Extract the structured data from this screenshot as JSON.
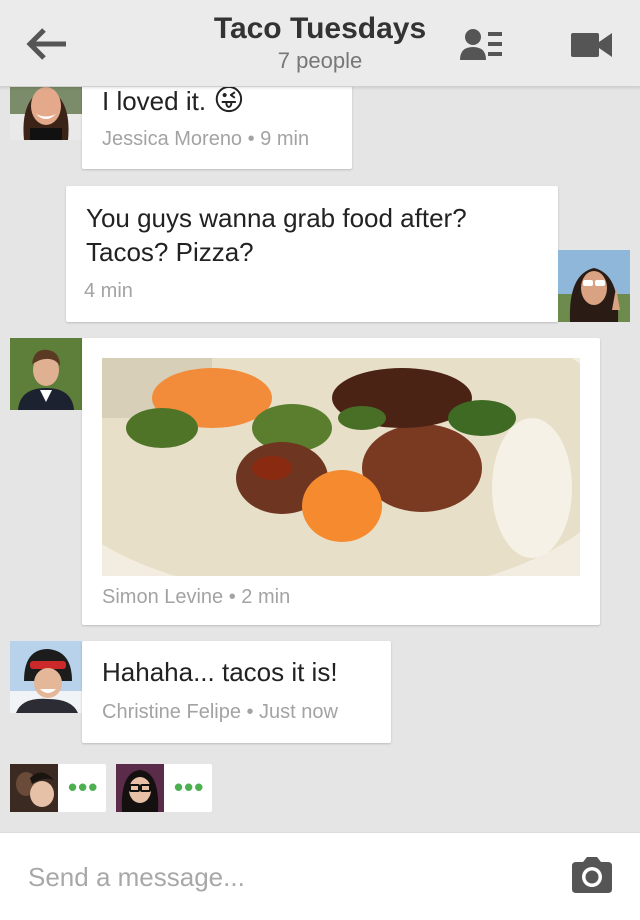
{
  "header": {
    "title": "Taco Tuesdays",
    "subtitle": "7 people",
    "icons": [
      "back-arrow-icon",
      "people-list-icon",
      "video-call-icon"
    ]
  },
  "messages": [
    {
      "text": "I loved it.",
      "emoji": "😜",
      "author": "Jessica Moreno",
      "time": "9 min",
      "meta": "Jessica Moreno • 9 min"
    },
    {
      "text_line1": "You guys wanna grab food after?",
      "text_line2": "Tacos? Pizza?",
      "time": "4 min",
      "meta": "4 min",
      "own": true
    },
    {
      "type": "photo",
      "author": "Simon Levine",
      "time": "2 min",
      "meta": "Simon Levine • 2 min"
    },
    {
      "text": "Hahaha... tacos it is!",
      "author": "Christine Felipe",
      "time": "Just now",
      "meta": "Christine Felipe • Just now"
    }
  ],
  "typing": {
    "indicator": "•••"
  },
  "composer": {
    "placeholder": "Send a message..."
  },
  "colors": {
    "background": "#e5e5e5",
    "header": "#ebebeb",
    "typing_dots": "#4caf50",
    "meta_text": "#a3a3a3"
  }
}
